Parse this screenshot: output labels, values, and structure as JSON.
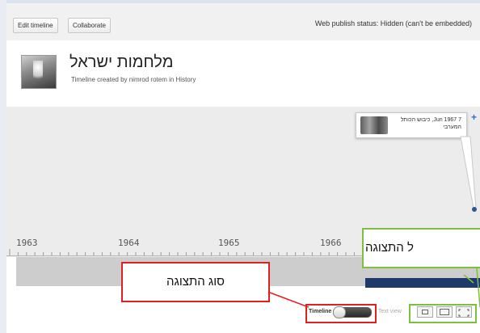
{
  "toolbar": {
    "edit_timeline_label": "Edit timeline",
    "collaborate_label": "Collaborate",
    "publish_status": "Web publish status: Hidden (can't be embedded)"
  },
  "header": {
    "title": "מלחמות ישראל",
    "subtitle": "Timeline created by nimrod rotem in History"
  },
  "event": {
    "date_text": "7 Jun 1967, כיבוש הכותל",
    "desc_text": "המערבי",
    "plus_icon": "plus-icon"
  },
  "ruler": {
    "years": [
      "1963",
      "1964",
      "1965",
      "1966"
    ]
  },
  "controls": {
    "timeline_label": "Timeline",
    "text_view_label": "Text view"
  },
  "annotations": {
    "display_type_label": "סוג התצוגה",
    "display_size_label": "ל התצוגה"
  },
  "colors": {
    "highlight_red": "#e02020",
    "highlight_green": "#7fbf3f",
    "accent_blue": "#2f568f"
  }
}
